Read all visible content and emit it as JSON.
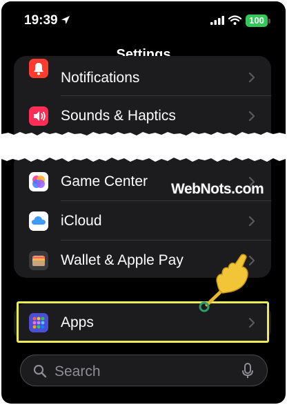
{
  "status_bar": {
    "time": "19:39",
    "battery": "100",
    "icons": [
      "location-arrow-icon",
      "cellular-signal-icon",
      "wifi-icon",
      "battery-icon"
    ]
  },
  "page": {
    "title": "Settings"
  },
  "groups": {
    "top": [
      {
        "label": "Notifications",
        "icon": "bell-icon",
        "color": "#ff3b30"
      },
      {
        "label": "Sounds & Haptics",
        "icon": "speaker-icon",
        "color": "#ff2d55"
      }
    ],
    "middle": [
      {
        "label": "Game Center",
        "icon": "game-center-icon",
        "color": "#ffffff"
      },
      {
        "label": "iCloud",
        "icon": "cloud-icon",
        "color": "#ffffff"
      },
      {
        "label": "Wallet & Apple Pay",
        "icon": "wallet-icon",
        "color": "#3a3a3c"
      }
    ],
    "bottom": [
      {
        "label": "Apps",
        "icon": "apps-grid-icon",
        "color": "#5e5ce6"
      }
    ]
  },
  "search": {
    "placeholder": "Search"
  },
  "watermark": "WebNots.com",
  "colors": {
    "background": "#000000",
    "group": "#1c1c1e",
    "highlight": "#ecec5a",
    "battery": "#34c759"
  }
}
